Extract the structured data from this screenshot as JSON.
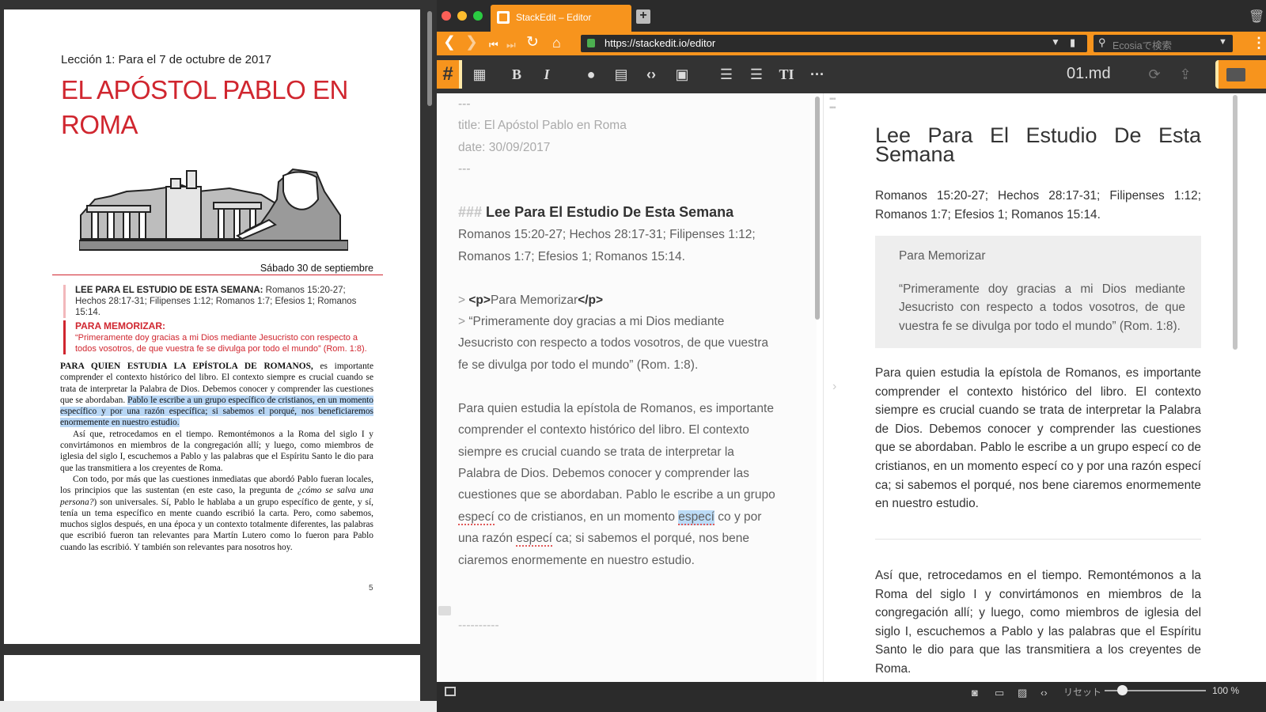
{
  "pdf": {
    "lesson_line": "Lección 1: Para el 7 de octubre de 2017",
    "title": "EL APÓSTOL PABLO EN ROMA",
    "date_line": "Sábado 30 de septiembre",
    "lee_label": "LEE PARA EL ESTUDIO DE ESTA SEMANA:",
    "lee_refs": " Romanos 15:20-27; Hechos 28:17-31; Filipenses 1:12; Romanos 1:7; Efesios 1; Romanos 15:14.",
    "memo_label": "PARA MEMORIZAR:",
    "memo_text": "“Primeramente doy gracias a mi Dios mediante Jesucristo con respecto a todos vosotros, de que vuestra fe se divulga por todo el mundo” (Rom. 1:8).",
    "p1_lead": "PARA QUIEN ESTUDIA LA EPÍSTOLA DE ROMANOS,",
    "p1_text": " es importante comprender el contexto histórico del libro. El contexto siempre es crucial cuando se trata de interpretar la Palabra de Dios. Debemos conocer y comprender las cuestiones que se abordaban. ",
    "p1_highlight": "Pablo le escribe a un grupo específico de cristianos, en un momento específico y por una razón específica; si sabemos el porqué, nos beneficiaremos enormemente en nuestro estudio.",
    "p2": "Así que, retrocedamos en el tiempo. Remontémonos a la Roma del siglo I y convirtámonos en miembros de la congregación allí; y luego, como miembros de iglesia del siglo I, escuchemos a Pablo y las palabras que el Espíritu Santo le dio para que las transmitiera a los creyentes de Roma.",
    "p3_a": "Con todo, por más que las cuestiones inmediatas que abordó Pablo fueran locales, los principios que las sustentan (en este caso, la pregunta de ",
    "p3_em": "¿cómo se salva una persona?",
    "p3_b": ") son universales. Sí, Pablo le hablaba a un grupo específico de gente, y sí, tenía un tema específico en mente cuando escribió la carta. Pero, como sabemos, muchos siglos después, en una época y un contexto totalmente diferentes, las palabras que escribió fueron tan relevantes para Martín Lutero como lo fueron para Pablo cuando las escribió. Y también son relevantes para nosotros hoy.",
    "page_number": "5"
  },
  "browser": {
    "tab_title": "StackEdit – Editor",
    "url": "https://stackedit.io/editor",
    "search_placeholder": "Ecosiaで検索",
    "filename": "01.md",
    "toolbar_hash": "#",
    "toolbar_bold": "B",
    "toolbar_italic": "I",
    "toolbar_heading": "TI",
    "toolbar_more": "···"
  },
  "editor": {
    "fm_open": "---",
    "fm_title": "title:  El Apóstol Pablo en Roma",
    "fm_date": "date:   30/09/2017",
    "fm_close": "---",
    "h3_marks": "### ",
    "h3_text": "Lee Para El Estudio De Esta Semana",
    "refs_1": "Romanos 15:20-27; Hechos 28:17-31; Filipenses 1:12;",
    "refs_2": "Romanos 1:7; Efesios 1; Romanos 15:14.",
    "bq_marker": "> ",
    "bq_tag_open": "<p>",
    "bq_memo": "Para Memorizar",
    "bq_tag_close": "</p>",
    "bq_l2": "“Primeramente doy gracias a mi Dios mediante",
    "bq_l3": "Jesucristo con respecto a todos vosotros, de que vuestra",
    "bq_l4": "fe se divulga por todo el mundo” (Rom. 1:8).",
    "p_l1": "Para quien estudia la epístola de Romanos, es importante",
    "p_l2": "comprender el contexto histórico del libro. El contexto",
    "p_l3": "siempre es crucial cuando se trata de interpretar la",
    "p_l4": "Palabra de Dios. Debemos conocer y comprender las",
    "p_l5": "cuestiones que se abordaban. Pablo le escribe a un grupo",
    "p_l6a": "especí",
    "p_l6b": " co de cristianos, en un momento ",
    "p_l6c": "especí",
    "p_l6d": " co y por",
    "p_l7a": "una razón ",
    "p_l7b": "especí",
    "p_l7c": " ca; si sabemos el porqué, nos bene",
    "p_l8": "ciaremos enormemente en nuestro estudio.",
    "hr": "----------"
  },
  "preview": {
    "heading": "Lee Para El Estudio De Esta Semana",
    "refs": "Romanos 15:20-27; Hechos 28:17-31; Filipenses 1:12; Romanos 1:7; Efesios 1; Romanos 15:14.",
    "quote_title": "Para Memorizar",
    "quote_text": "“Primeramente doy gracias a mi Dios mediante Jesucristo con respecto a todos vosotros, de que vuestra fe se divulga por todo el mundo” (Rom. 1:8).",
    "p1": "Para quien estudia la epístola de Romanos, es importante comprender el contexto histórico del libro. El contexto siempre es crucial cuando se trata de interpretar la Palabra de Dios. Debemos conocer y comprender las cuestiones que se abordaban. Pablo le escribe a un grupo especí co de cristianos, en un momento especí co y por una razón especí ca; si sabemos el porqué, nos bene ciaremos enormemente en nuestro estudio.",
    "p2": "Así que, retrocedamos en el tiempo. Remontémonos a la Roma del siglo I y convirtámonos en miembros de la congregación allí; y luego, como miembros de iglesia del siglo I, escuchemos a Pablo y las palabras que el Espíritu Santo le dio para que las transmitiera a los creyentes de Roma."
  },
  "statusbar": {
    "reset_label": "リセット",
    "zoom": "100 %"
  },
  "colors": {
    "accent": "#f7941d",
    "pdf_red": "#d0262f",
    "highlight": "#b9d7f5"
  }
}
